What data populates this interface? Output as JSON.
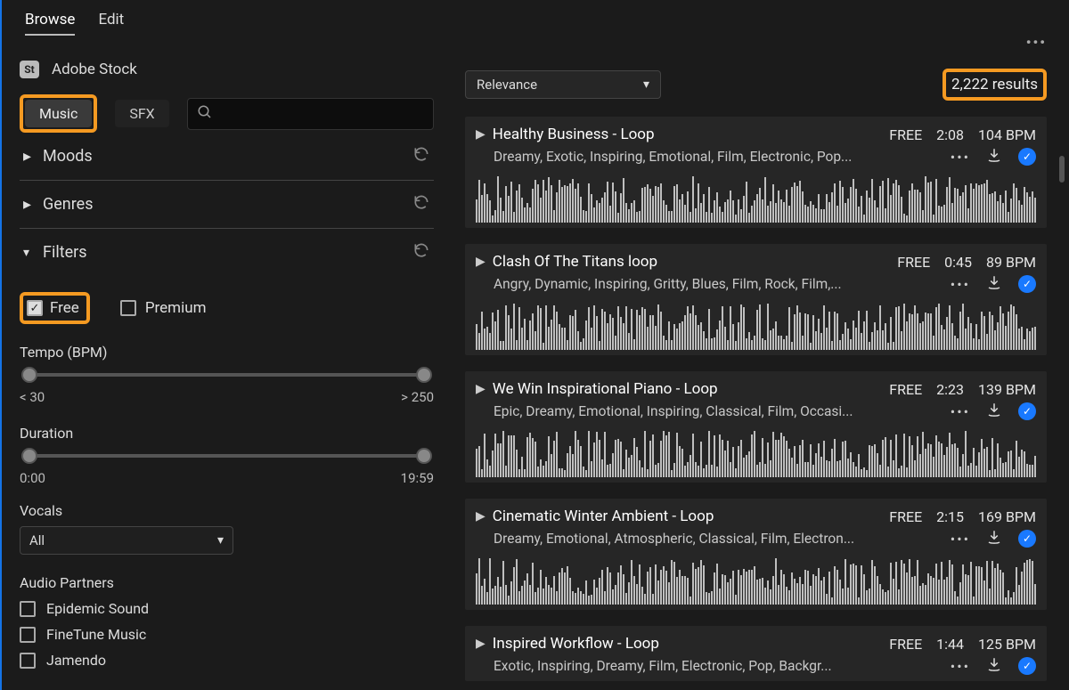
{
  "topTabs": {
    "browse": "Browse",
    "edit": "Edit"
  },
  "stock": {
    "badge": "St",
    "label": "Adobe Stock"
  },
  "segments": {
    "music": "Music",
    "sfx": "SFX"
  },
  "sort": {
    "label": "Relevance"
  },
  "resultsCount": "2,222 results",
  "filters": {
    "moods": "Moods",
    "genres": "Genres",
    "filters": "Filters",
    "free": "Free",
    "premium": "Premium",
    "tempoLabel": "Tempo (BPM)",
    "tempoMin": "< 30",
    "tempoMax": "> 250",
    "durationLabel": "Duration",
    "durMin": "0:00",
    "durMax": "19:59",
    "vocalsLabel": "Vocals",
    "vocalsValue": "All",
    "partnersLabel": "Audio Partners",
    "partners": [
      "Epidemic Sound",
      "FineTune Music",
      "Jamendo"
    ]
  },
  "tracks": [
    {
      "title": "Healthy Business - Loop",
      "free": "FREE",
      "time": "2:08",
      "bpm": "104 BPM",
      "tags": "Dreamy, Exotic, Inspiring, Emotional, Film, Electronic, Pop..."
    },
    {
      "title": "Clash Of The Titans loop",
      "free": "FREE",
      "time": "0:45",
      "bpm": "89 BPM",
      "tags": "Angry, Dynamic, Inspiring, Gritty, Blues, Film, Rock, Film,..."
    },
    {
      "title": "We Win Inspirational Piano - Loop",
      "free": "FREE",
      "time": "2:23",
      "bpm": "139 BPM",
      "tags": "Epic, Dreamy, Emotional, Inspiring, Classical, Film, Occasi..."
    },
    {
      "title": "Cinematic Winter Ambient - Loop",
      "free": "FREE",
      "time": "2:15",
      "bpm": "169 BPM",
      "tags": "Dreamy, Emotional, Atmospheric, Classical, Film, Electron..."
    },
    {
      "title": "Inspired Workflow - Loop",
      "free": "FREE",
      "time": "1:44",
      "bpm": "125 BPM",
      "tags": "Exotic, Inspiring, Dreamy, Film, Electronic, Pop, Backgr..."
    }
  ]
}
